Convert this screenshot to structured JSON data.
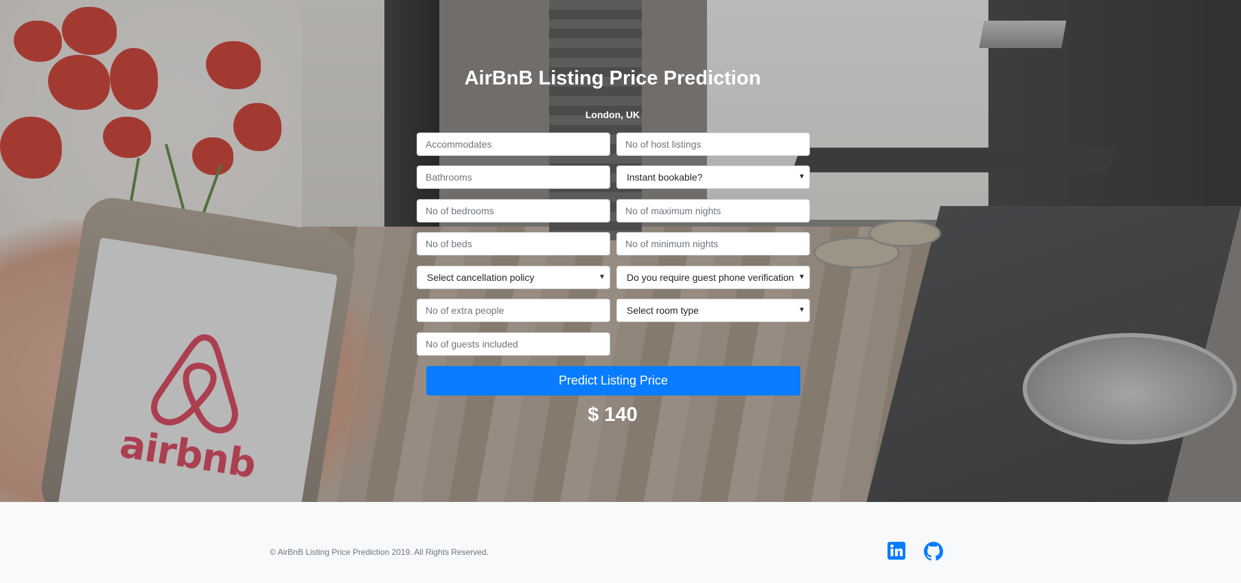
{
  "header": {
    "title": "AirBnB Listing Price Prediction",
    "location": "London, UK"
  },
  "form": {
    "accommodates": {
      "placeholder": "Accommodates"
    },
    "host_listings": {
      "placeholder": "No of host listings"
    },
    "bathrooms": {
      "placeholder": "Bathrooms"
    },
    "instant_bookable": {
      "selected": "Instant bookable?"
    },
    "bedrooms": {
      "placeholder": "No of bedrooms"
    },
    "maximum_nights": {
      "placeholder": "No of maximum nights"
    },
    "beds": {
      "placeholder": "No of beds"
    },
    "minimum_nights": {
      "placeholder": "No of minimum nights"
    },
    "cancellation_policy": {
      "selected": "Select cancellation policy"
    },
    "phone_verification": {
      "selected": "Do you require guest phone verification"
    },
    "extra_people": {
      "placeholder": "No of extra people"
    },
    "room_type": {
      "selected": "Select room type"
    },
    "guests_included": {
      "placeholder": "No of guests included"
    },
    "submit_label": "Predict Listing Price"
  },
  "result": {
    "price_text": "$ 140"
  },
  "footer": {
    "copyright": "© AirBnB Listing Price Prediction 2019. All Rights Reserved.",
    "social": [
      {
        "name": "linkedin-icon"
      },
      {
        "name": "github-icon"
      }
    ]
  },
  "colors": {
    "accent": "#0a7cff",
    "airbnb_brand": "#e0415a",
    "footer_bg": "#f8f9fa"
  },
  "background_logo_text": "airbnb"
}
